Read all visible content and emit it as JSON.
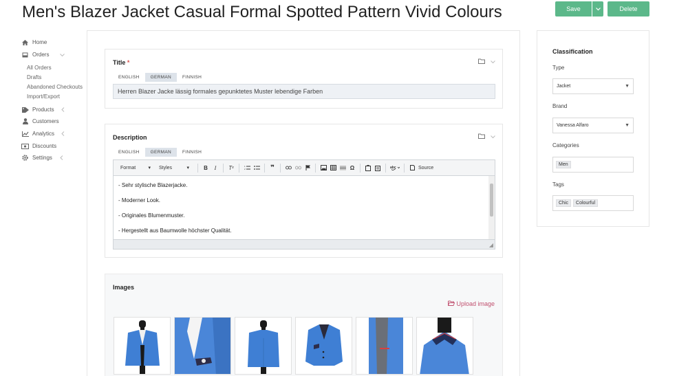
{
  "page": {
    "title": "Men's Blazer Jacket Casual Formal Spotted Pattern Vivid Colours"
  },
  "actions": {
    "save_label": "Save",
    "delete_label": "Delete"
  },
  "colors": {
    "primary_button": "#5cb88a",
    "required_mark": "#d9534f",
    "upload_link": "#c0506f"
  },
  "sidebar": {
    "items": [
      {
        "label": "Home",
        "icon": "home-icon"
      },
      {
        "label": "Orders",
        "icon": "inbox-icon"
      },
      {
        "label": "Products",
        "icon": "tag-icon"
      },
      {
        "label": "Customers",
        "icon": "user-icon"
      },
      {
        "label": "Analytics",
        "icon": "chart-icon"
      },
      {
        "label": "Discounts",
        "icon": "ticket-icon"
      },
      {
        "label": "Settings",
        "icon": "gear-icon"
      }
    ],
    "order_subitems": [
      "All Orders",
      "Drafts",
      "Abandoned Checkouts",
      "Import/Export"
    ]
  },
  "title_card": {
    "label": "Title",
    "required": "*",
    "tabs": [
      "ENGLISH",
      "GERMAN",
      "FINNISH"
    ],
    "active_tab": "GERMAN",
    "value": "Herren Blazer Jacke lässig formales gepunktetes Muster lebendige Farben"
  },
  "description_card": {
    "label": "Description",
    "tabs": [
      "ENGLISH",
      "GERMAN",
      "FINNISH"
    ],
    "active_tab": "GERMAN",
    "toolbar": {
      "format_label": "Format",
      "styles_label": "Styles",
      "source_label": "Source"
    },
    "lines": [
      "- Sehr stylische Blazerjacke.",
      "- Moderner Look.",
      "- Originales Blumenmuster.",
      "- Hergestellt aus Baumwolle höchster Qualität."
    ]
  },
  "images_card": {
    "label": "Images",
    "upload_label": "Upload image",
    "thumb_count": 6
  },
  "classification": {
    "title": "Classification",
    "type_label": "Type",
    "type_value": "Jacket",
    "brand_label": "Brand",
    "brand_value": "Vanessa Alfaro",
    "categories_label": "Categories",
    "categories": [
      "Men"
    ],
    "tags_label": "Tags",
    "tags": [
      "Chic",
      "Colourful"
    ]
  }
}
